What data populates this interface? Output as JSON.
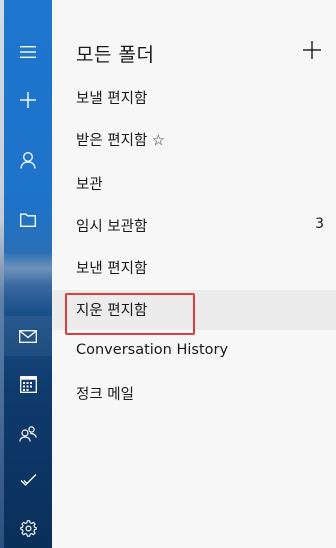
{
  "sidebar": {
    "accent": "#1e76cf",
    "buttons": [
      {
        "name": "hamburger-menu-icon"
      },
      {
        "name": "plus-icon"
      },
      {
        "name": "person-icon"
      },
      {
        "name": "folder-icon"
      },
      {
        "name": "mail-icon"
      },
      {
        "name": "calendar-icon"
      },
      {
        "name": "people-icon"
      },
      {
        "name": "checkmark-icon"
      },
      {
        "name": "gear-icon"
      }
    ]
  },
  "folders_panel": {
    "title": "모든 폴더",
    "add_icon": "plus-icon",
    "items": [
      {
        "label": "보낼 편지함",
        "count": ""
      },
      {
        "label": "받은 편지함 ☆",
        "count": ""
      },
      {
        "label": "보관",
        "count": ""
      },
      {
        "label": "임시 보관함",
        "count": "3"
      },
      {
        "label": "보낸 편지함",
        "count": ""
      },
      {
        "label": "지운 편지함",
        "count": "",
        "highlighted": true
      },
      {
        "label": "Conversation History",
        "count": ""
      },
      {
        "label": "정크 메일",
        "count": ""
      }
    ],
    "highlight_color": "#e23d3d"
  }
}
